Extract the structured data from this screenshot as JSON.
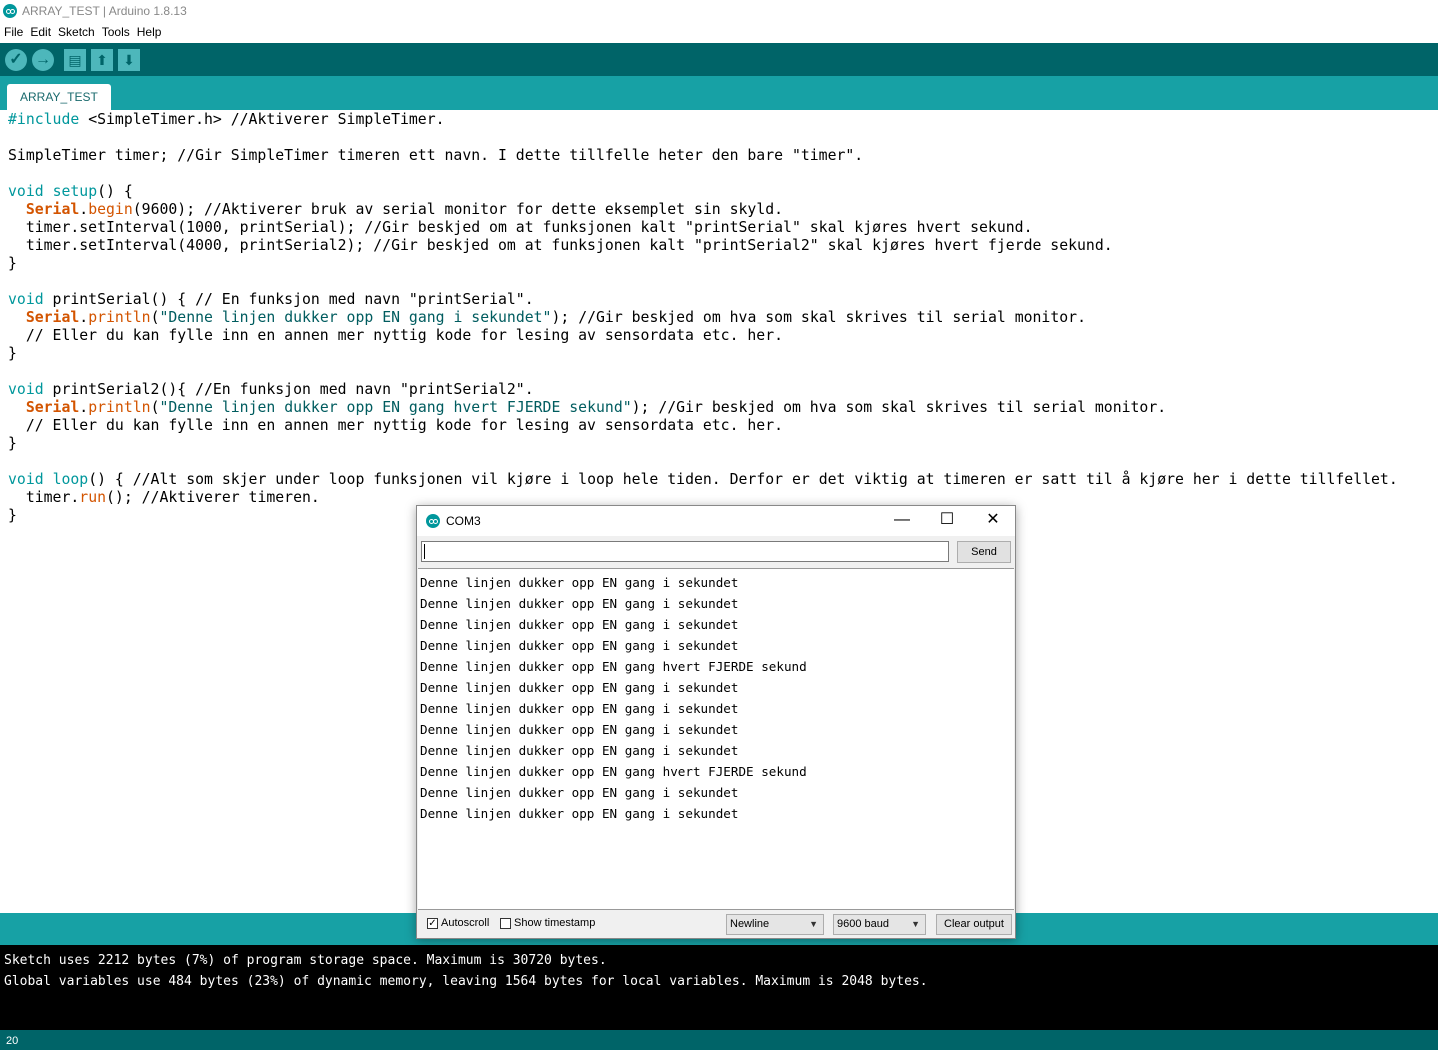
{
  "window": {
    "title": "ARRAY_TEST | Arduino 1.8.13"
  },
  "menu": [
    "File",
    "Edit",
    "Sketch",
    "Tools",
    "Help"
  ],
  "toolbar": {
    "verify_icon": "checkmark-icon",
    "upload_icon": "arrow-right-icon",
    "new_icon": "new-file-icon",
    "open_icon": "arrow-up-icon",
    "save_icon": "arrow-down-icon"
  },
  "tab": {
    "label": "ARRAY_TEST"
  },
  "code": {
    "l1a": "#include",
    "l1b": " <SimpleTimer.h> //Aktiverer SimpleTimer.",
    "l3": "SimpleTimer timer; //Gir SimpleTimer timeren ett navn. I dette tillfelle heter den bare \"timer\".",
    "l5a": "void",
    "l5b": " ",
    "l5c": "setup",
    "l5d": "() {",
    "l6a": "Serial",
    "l6b": ".",
    "l6c": "begin",
    "l6d": "(9600); //Aktiverer bruk av serial monitor for dette eksemplet sin skyld.",
    "l7": "  timer.setInterval(1000, printSerial); //Gir beskjed om at funksjonen kalt \"printSerial\" skal kjøres hvert sekund.",
    "l8": "  timer.setInterval(4000, printSerial2); //Gir beskjed om at funksjonen kalt \"printSerial2\" skal kjøres hvert fjerde sekund.",
    "l9": "}",
    "l11a": "void",
    "l11b": " printSerial() { // En funksjon med navn \"printSerial\".",
    "l12a": "Serial",
    "l12b": ".",
    "l12c": "println",
    "l12d": "(",
    "l12e": "\"Denne linjen dukker opp EN gang i sekundet\"",
    "l12f": "); //Gir beskjed om hva som skal skrives til serial monitor.",
    "l13": "  // Eller du kan fylle inn en annen mer nyttig kode for lesing av sensordata etc. her.",
    "l14": "}",
    "l16a": "void",
    "l16b": " printSerial2(){ //En funksjon med navn \"printSerial2\".",
    "l17a": "Serial",
    "l17b": ".",
    "l17c": "println",
    "l17d": "(",
    "l17e": "\"Denne linjen dukker opp EN gang hvert FJERDE sekund\"",
    "l17f": "); //Gir beskjed om hva som skal skrives til serial monitor.",
    "l18": "  // Eller du kan fylle inn en annen mer nyttig kode for lesing av sensordata etc. her.",
    "l19": "}",
    "l21a": "void",
    "l21b": " ",
    "l21c": "loop",
    "l21d": "() { //Alt som skjer under loop funksjonen vil kjøre i loop hele tiden. Derfor er det viktig at timeren er satt til å kjøre her i dette tillfellet.",
    "l22a": "  timer.",
    "l22b": "run",
    "l22c": "(); //Aktiverer timeren.",
    "l23": "}"
  },
  "console": {
    "line1": "Sketch uses 2212 bytes (7%) of program storage space. Maximum is 30720 bytes.",
    "line2": "Global variables use 484 bytes (23%) of dynamic memory, leaving 1564 bytes for local variables. Maximum is 2048 bytes."
  },
  "status": {
    "line": "20"
  },
  "serial_monitor": {
    "title": "COM3",
    "minimize": "—",
    "maximize": "☐",
    "close": "✕",
    "input_value": "",
    "send_label": "Send",
    "output": [
      "Denne linjen dukker opp EN gang i sekundet",
      "Denne linjen dukker opp EN gang i sekundet",
      "Denne linjen dukker opp EN gang i sekundet",
      "Denne linjen dukker opp EN gang i sekundet",
      "Denne linjen dukker opp EN gang hvert FJERDE sekund",
      "Denne linjen dukker opp EN gang i sekundet",
      "Denne linjen dukker opp EN gang i sekundet",
      "Denne linjen dukker opp EN gang i sekundet",
      "Denne linjen dukker opp EN gang i sekundet",
      "Denne linjen dukker opp EN gang hvert FJERDE sekund",
      "Denne linjen dukker opp EN gang i sekundet",
      "Denne linjen dukker opp EN gang i sekundet"
    ],
    "autoscroll_label": "Autoscroll",
    "autoscroll_checked": true,
    "timestamp_label": "Show timestamp",
    "timestamp_checked": false,
    "line_ending": "Newline",
    "baud": "9600 baud",
    "clear_label": "Clear output"
  },
  "colors": {
    "toolbar": "#006468",
    "tabbar": "#17a1a5",
    "keyword": "#00979c",
    "serial": "#d35400"
  }
}
